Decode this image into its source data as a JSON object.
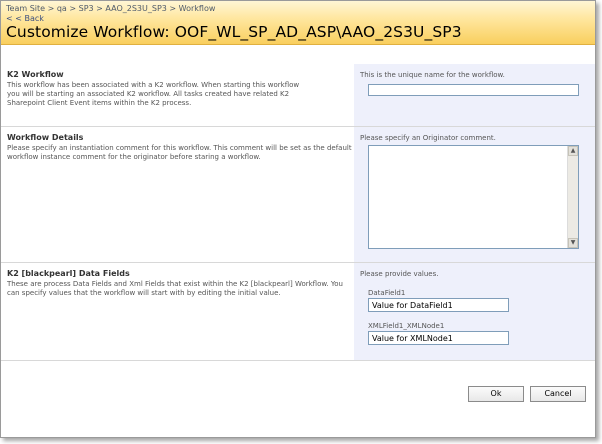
{
  "header": {
    "breadcrumb": [
      "Team Site",
      "qa",
      "SP3",
      "AAO_2S3U_SP3",
      "Workflow"
    ],
    "breadcrumb_separator": " > ",
    "back_label": "< < Back",
    "title": "Customize Workflow: OOF_WL_SP_AD_ASP\\AAO_2S3U_SP3"
  },
  "sections": {
    "k2_workflow": {
      "title": "K2 Workflow",
      "description": [
        "This workflow has been associated with a K2 workflow. When starting this workflow",
        "you will be starting an associated K2 workflow. All tasks created have related K2",
        "Sharepoint Client Event items within the K2 process."
      ],
      "hint": "This is the unique name for the workflow.",
      "name_value": ""
    },
    "workflow_details": {
      "title": "Workflow Details",
      "description": [
        "Please specify an instantiation comment for this workflow. This comment will be set as the default",
        "workflow instance comment for the originator before staring a workflow."
      ],
      "hint": "Please specify an Originator comment.",
      "comment_value": ""
    },
    "data_fields": {
      "title": "K2 [blackpearl] Data Fields",
      "description": [
        "These are process Data Fields and Xml Fields that exist within the K2 [blackpearl] Workflow. You",
        "can specify values that the workflow will start with by editing the initial value."
      ],
      "hint": "Please provide values.",
      "fields": [
        {
          "label": "DataField1",
          "value": "Value for DataField1"
        },
        {
          "label": "XMLField1_XMLNode1",
          "value": "Value for XMLNode1"
        }
      ]
    }
  },
  "buttons": {
    "ok_label": "Ok",
    "cancel_label": "Cancel"
  },
  "icons": {
    "scroll_up": "▲",
    "scroll_down": "▼"
  }
}
